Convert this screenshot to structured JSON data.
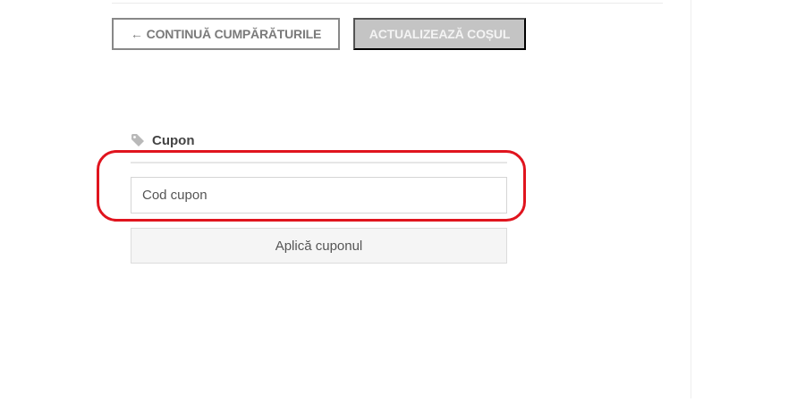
{
  "cart_actions": {
    "continue_arrow": "←",
    "continue_label": "CONTINUĂ CUMPĂRĂTURILE",
    "update_label": "ACTUALIZEAZĂ COȘUL"
  },
  "coupon": {
    "icon": "tag-icon",
    "title": "Cupon",
    "input_placeholder": "Cod cupon",
    "input_value": "",
    "apply_label": "Aplică cuponul"
  },
  "colors": {
    "highlight": "#e0141e",
    "update_button_bg": "#c4c4c4",
    "continue_border": "#888888"
  }
}
